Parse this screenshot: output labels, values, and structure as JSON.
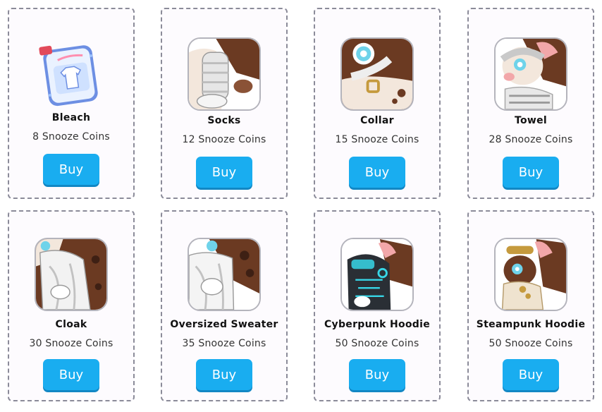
{
  "items": [
    {
      "name": "Bleach",
      "price": "8 Snooze Coins",
      "buy_label": "Buy",
      "icon": "bleach-bottle-icon"
    },
    {
      "name": "Socks",
      "price": "12 Snooze Coins",
      "buy_label": "Buy",
      "icon": "socks-preview"
    },
    {
      "name": "Collar",
      "price": "15 Snooze Coins",
      "buy_label": "Buy",
      "icon": "collar-preview"
    },
    {
      "name": "Towel",
      "price": "28 Snooze Coins",
      "buy_label": "Buy",
      "icon": "towel-preview"
    },
    {
      "name": "Cloak",
      "price": "30 Snooze Coins",
      "buy_label": "Buy",
      "icon": "cloak-preview"
    },
    {
      "name": "Oversized Sweater",
      "price": "35 Snooze Coins",
      "buy_label": "Buy",
      "icon": "sweater-preview"
    },
    {
      "name": "Cyberpunk Hoodie",
      "price": "50 Snooze Coins",
      "buy_label": "Buy",
      "icon": "cyberpunk-hoodie-preview"
    },
    {
      "name": "Steampunk Hoodie",
      "price": "50 Snooze Coins",
      "buy_label": "Buy",
      "icon": "steampunk-hoodie-preview"
    }
  ],
  "colors": {
    "button": "#19adf0",
    "card_border": "#8b8b99",
    "fur_brown": "#6b3a22",
    "fur_cream": "#f3e7dc",
    "ear_pink": "#f2a7a9",
    "cyber_teal": "#37d6e6",
    "brass": "#c59a3d"
  }
}
